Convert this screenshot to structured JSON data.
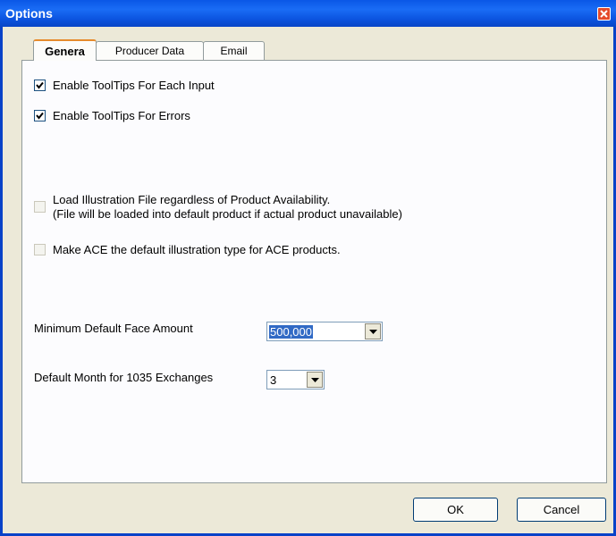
{
  "window": {
    "title": "Options"
  },
  "tabs": [
    {
      "label": "Genera"
    },
    {
      "label": "Producer Data"
    },
    {
      "label": "Email"
    }
  ],
  "general": {
    "tooltips_input": {
      "label": "Enable ToolTips For Each Input",
      "checked": true
    },
    "tooltips_errors": {
      "label": "Enable ToolTips For Errors",
      "checked": true
    },
    "load_illustration": {
      "label_line1": "Load Illustration File regardless of Product Availability.",
      "label_line2": "(File will be loaded into default product if actual product unavailable)",
      "checked": false
    },
    "ace_default": {
      "label": "Make ACE the default illustration type for ACE products.",
      "checked": false
    },
    "min_face_amount": {
      "label": "Minimum Default Face Amount",
      "value": "500,000"
    },
    "default_month": {
      "label": "Default Month for 1035 Exchanges",
      "value": "3"
    }
  },
  "buttons": {
    "ok": "OK",
    "cancel": "Cancel"
  }
}
